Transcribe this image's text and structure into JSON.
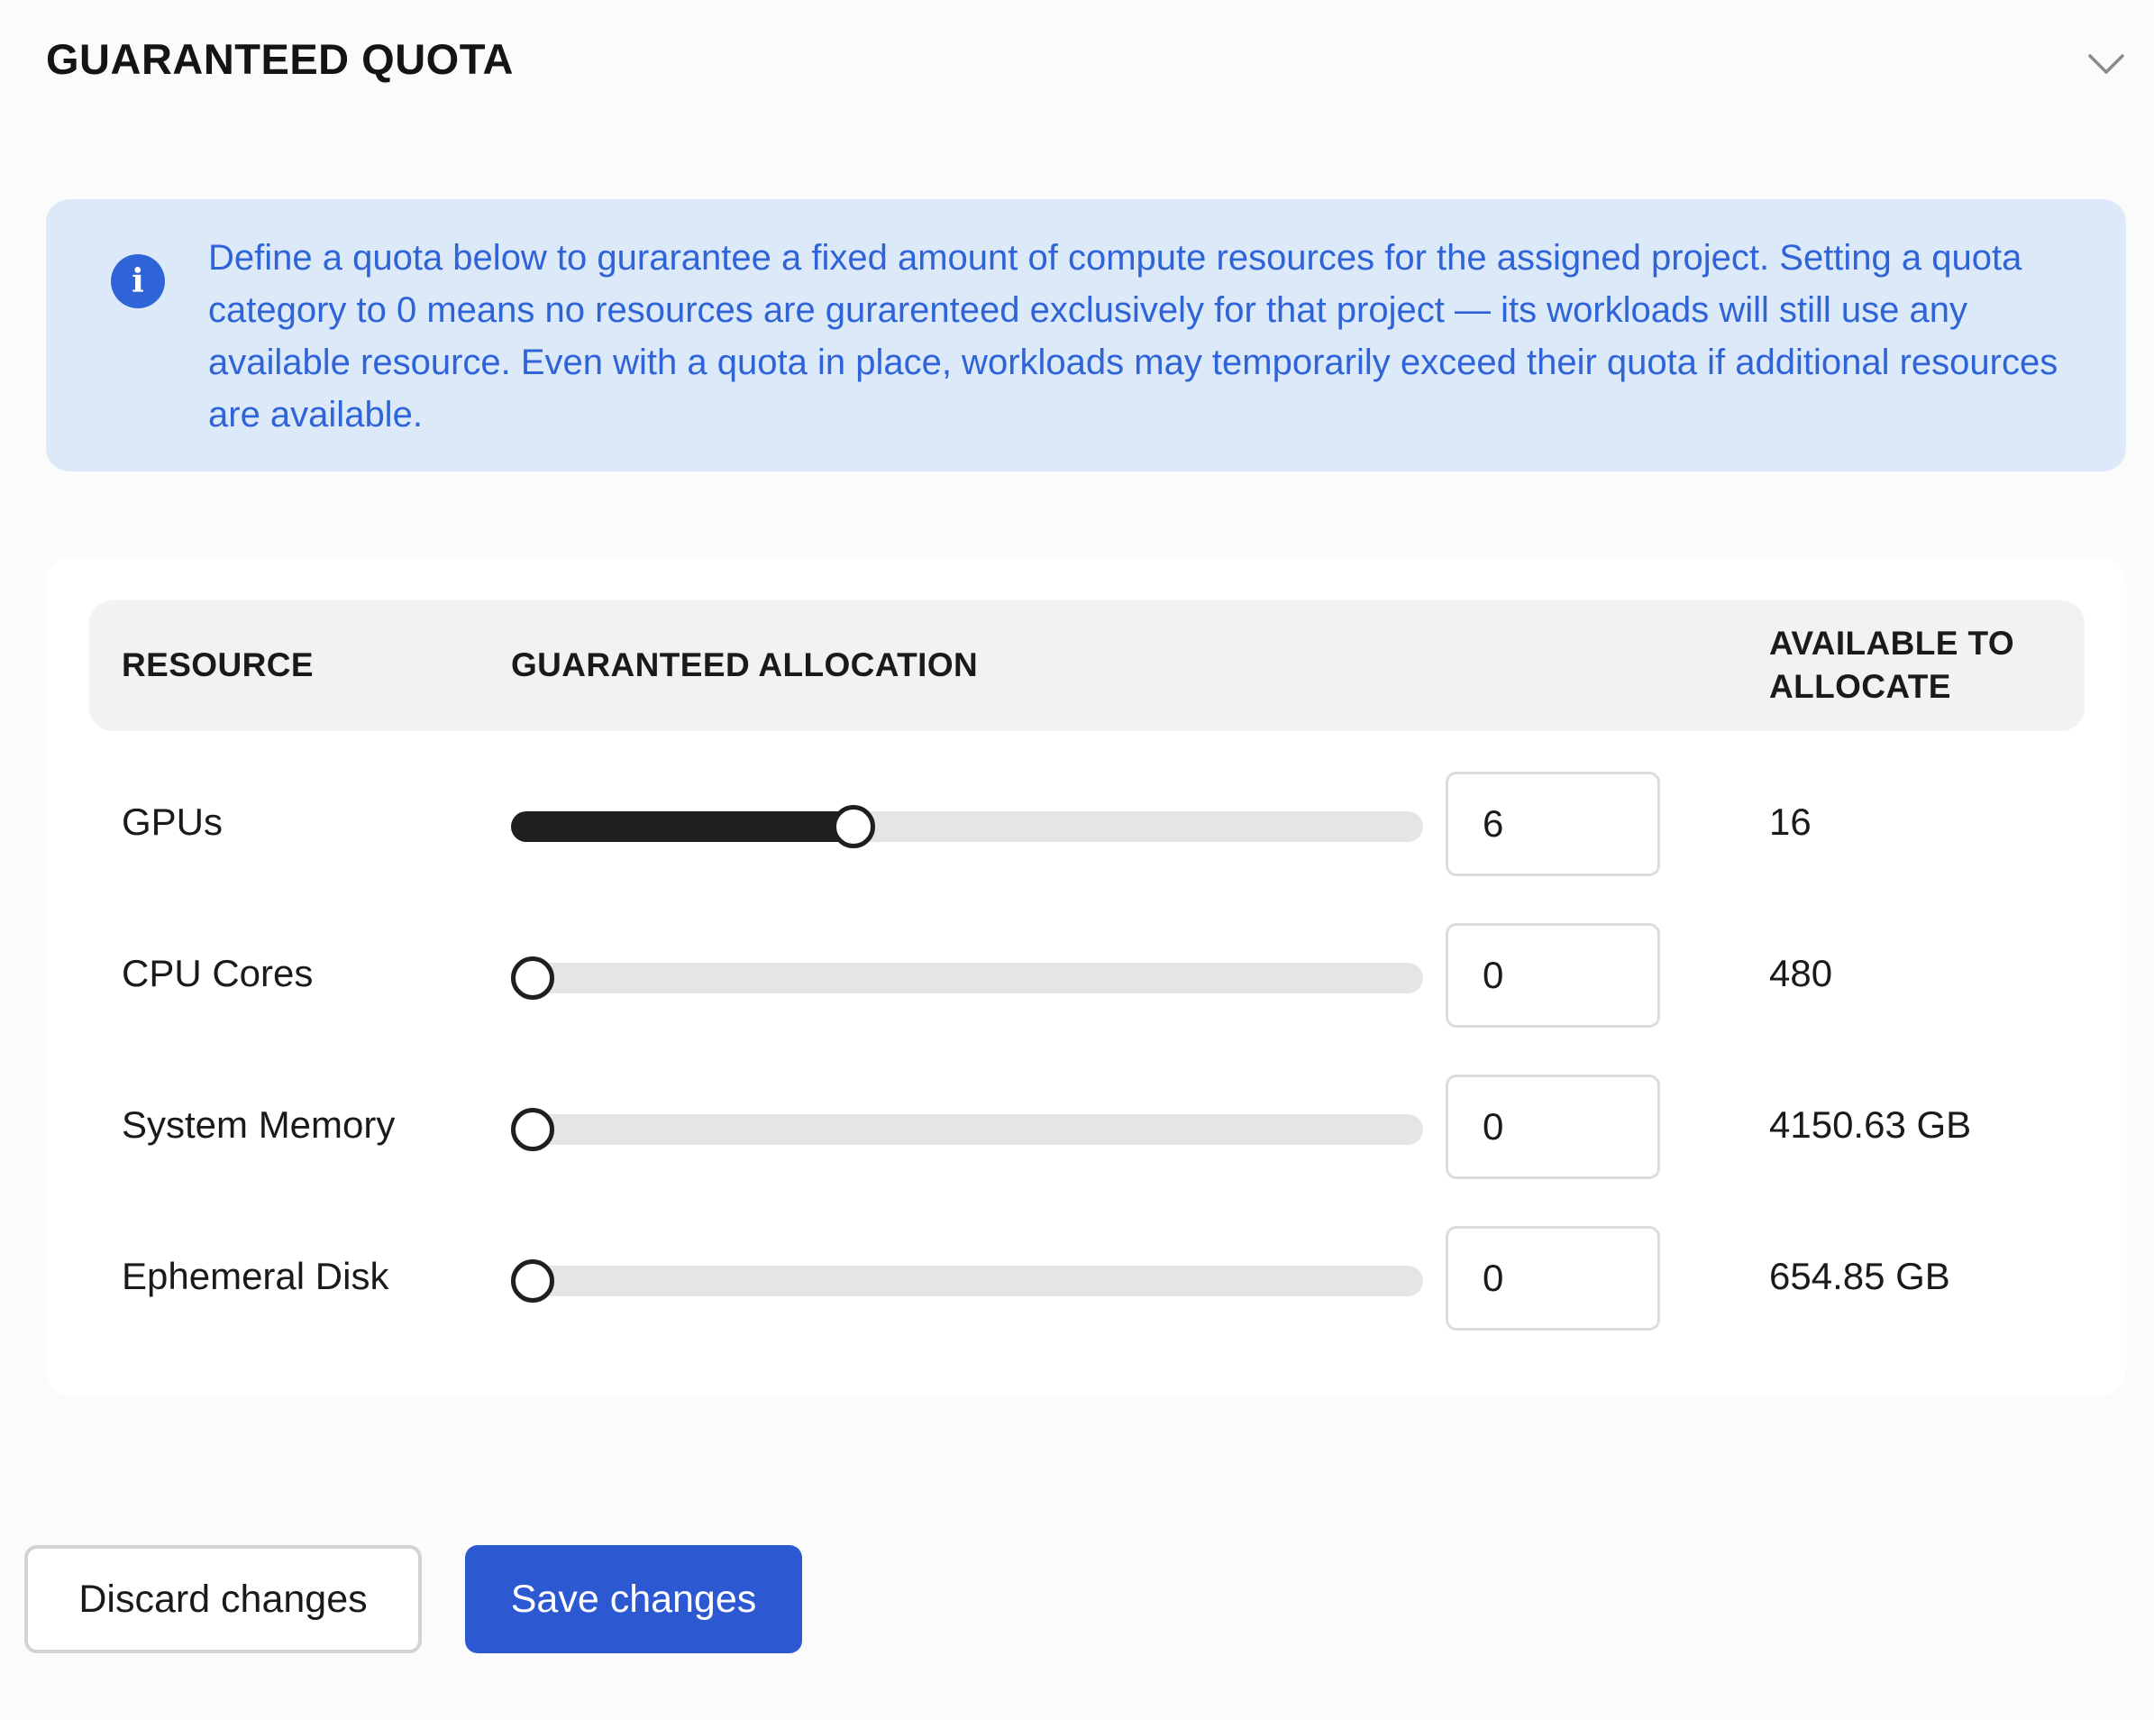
{
  "section": {
    "title": "GUARANTEED QUOTA",
    "collapse_icon": "chevron-down-icon"
  },
  "info": {
    "icon": "info-icon",
    "icon_glyph": "i",
    "text": "Define a quota below to gurarantee a fixed amount of compute resources for the assigned project. Setting a quota category to 0 means no resources are gurarenteed exclusively for that project — its workloads will still use any available resource. Even with a quota in place, workloads may temporarily exceed their quota if additional resources are available."
  },
  "table": {
    "headers": {
      "resource": "RESOURCE",
      "allocation": "GUARANTEED ALLOCATION",
      "available": "AVAILABLE TO ALLOCATE"
    },
    "rows": [
      {
        "name": "GPUs",
        "value": "6",
        "available": "16",
        "slider_fraction": 0.375
      },
      {
        "name": "CPU Cores",
        "value": "0",
        "available": "480",
        "slider_fraction": 0
      },
      {
        "name": "System Memory",
        "value": "0",
        "available": "4150.63 GB",
        "slider_fraction": 0
      },
      {
        "name": "Ephemeral Disk",
        "value": "0",
        "available": "654.85 GB",
        "slider_fraction": 0
      }
    ]
  },
  "actions": {
    "discard_label": "Discard changes",
    "save_label": "Save changes"
  },
  "colors": {
    "accent": "#2c59d1",
    "info_bg": "#dbe9f9",
    "info_text": "#2f63d8",
    "slider_fill": "#1f1f1f",
    "slider_track": "#e5e5e5"
  }
}
